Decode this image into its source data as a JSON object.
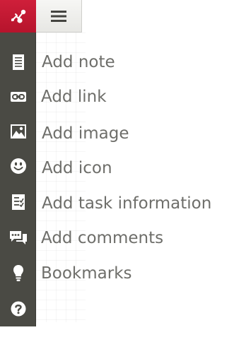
{
  "header": {
    "logo_icon": "mindmap-logo-icon",
    "menu_icon": "hamburger-menu-icon",
    "accent_color": "#c41a33"
  },
  "toolbar": {
    "items": [
      {
        "label": "Add note",
        "icon": "note-icon"
      },
      {
        "label": "Add link",
        "icon": "link-icon"
      },
      {
        "label": "Add image",
        "icon": "image-icon"
      },
      {
        "label": "Add icon",
        "icon": "smiley-icon"
      },
      {
        "label": "Add task information",
        "icon": "task-icon"
      },
      {
        "label": "Add comments",
        "icon": "comments-icon"
      },
      {
        "label": "Bookmarks",
        "icon": "lightbulb-icon"
      }
    ],
    "help_icon": "help-icon"
  }
}
